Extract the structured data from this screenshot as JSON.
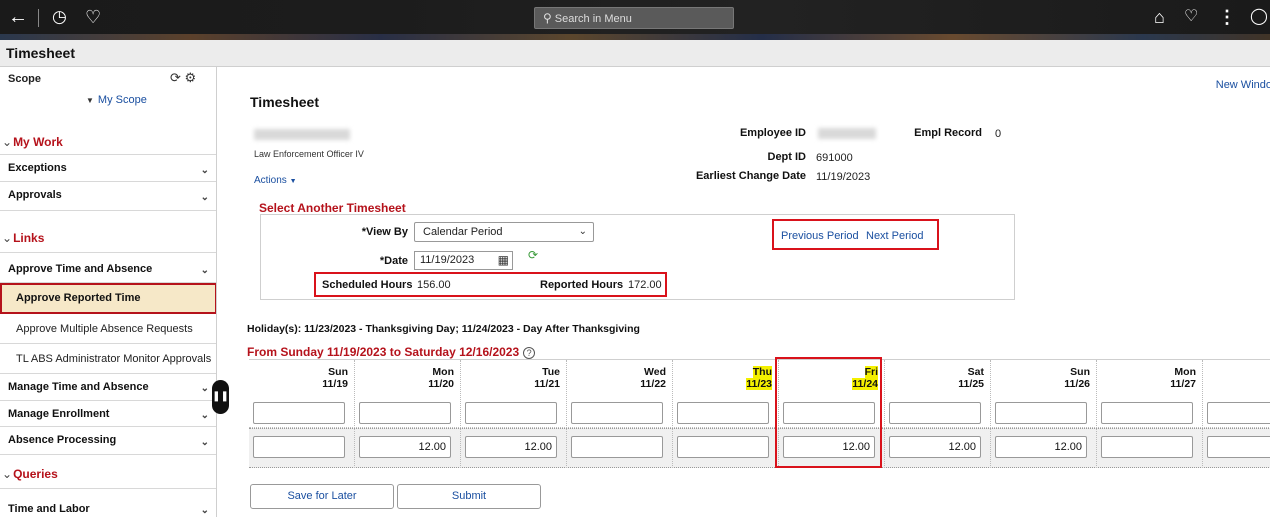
{
  "topbar": {
    "search_placeholder": "Search in Menu",
    "icons": [
      "back-icon",
      "history-icon",
      "favorites-icon",
      "home-icon",
      "notifications-icon",
      "more-icon",
      "navbar-icon"
    ]
  },
  "page": {
    "title": "Timesheet"
  },
  "sidebar": {
    "scope_title": "Scope",
    "scope_link": "My Scope",
    "items": [
      {
        "label": "My Work",
        "type": "section"
      },
      {
        "label": "Exceptions",
        "type": "group"
      },
      {
        "label": "Approvals",
        "type": "group"
      },
      {
        "label": "Links",
        "type": "section"
      },
      {
        "label": "Approve Time and Absence",
        "type": "group"
      },
      {
        "label": "Approve Reported Time",
        "type": "selected"
      },
      {
        "label": "Approve Multiple Absence Requests",
        "type": "item"
      },
      {
        "label": "TL ABS Administrator Monitor Approvals",
        "type": "item"
      },
      {
        "label": "Manage Time and Absence",
        "type": "group"
      },
      {
        "label": "Manage Enrollment",
        "type": "group"
      },
      {
        "label": "Absence Processing",
        "type": "group"
      },
      {
        "label": "Queries",
        "type": "section"
      },
      {
        "label": "Time and Labor",
        "type": "group"
      }
    ]
  },
  "main": {
    "new_window": "New Windo",
    "title": "Timesheet",
    "job_title": "Law Enforcement Officer IV",
    "actions": "Actions",
    "employee_id_label": "Employee ID",
    "empl_record_label": "Empl Record",
    "empl_record_value": "0",
    "dept_id_label": "Dept ID",
    "dept_id_value": "691000",
    "earliest_change_label": "Earliest Change Date",
    "earliest_change_value": "11/19/2023",
    "select_title": "Select Another Timesheet",
    "view_by_label": "*View By",
    "view_by_value": "Calendar Period",
    "date_label": "*Date",
    "date_value": "11/19/2023",
    "scheduled_label": "Scheduled Hours",
    "scheduled_value": "156.00",
    "reported_label": "Reported Hours",
    "reported_value": "172.00",
    "previous_period": "Previous Period",
    "next_period": "Next Period",
    "holiday_text": "Holiday(s): 11/23/2023 - Thanksgiving Day; 11/24/2023 - Day After Thanksgiving",
    "range_text": "From Sunday 11/19/2023 to Saturday 12/16/2023",
    "help": "?",
    "save_button": "Save for Later",
    "submit_button": "Submit"
  },
  "grid": {
    "days": [
      {
        "day": "Sun",
        "date": "11/19",
        "row1": "",
        "row2": "",
        "highlight": false
      },
      {
        "day": "Mon",
        "date": "11/20",
        "row1": "",
        "row2": "12.00",
        "highlight": false
      },
      {
        "day": "Tue",
        "date": "11/21",
        "row1": "",
        "row2": "12.00",
        "highlight": false
      },
      {
        "day": "Wed",
        "date": "11/22",
        "row1": "",
        "row2": "",
        "highlight": false
      },
      {
        "day": "Thu",
        "date": "11/23",
        "row1": "",
        "row2": "",
        "highlight": true
      },
      {
        "day": "Fri",
        "date": "11/24",
        "row1": "",
        "row2": "12.00",
        "highlight": true
      },
      {
        "day": "Sat",
        "date": "11/25",
        "row1": "",
        "row2": "12.00",
        "highlight": false
      },
      {
        "day": "Sun",
        "date": "11/26",
        "row1": "",
        "row2": "12.00",
        "highlight": false
      },
      {
        "day": "Mon",
        "date": "11/27",
        "row1": "",
        "row2": "",
        "highlight": false
      },
      {
        "day": "",
        "date": "",
        "row1": "",
        "row2": "",
        "highlight": false
      }
    ]
  }
}
